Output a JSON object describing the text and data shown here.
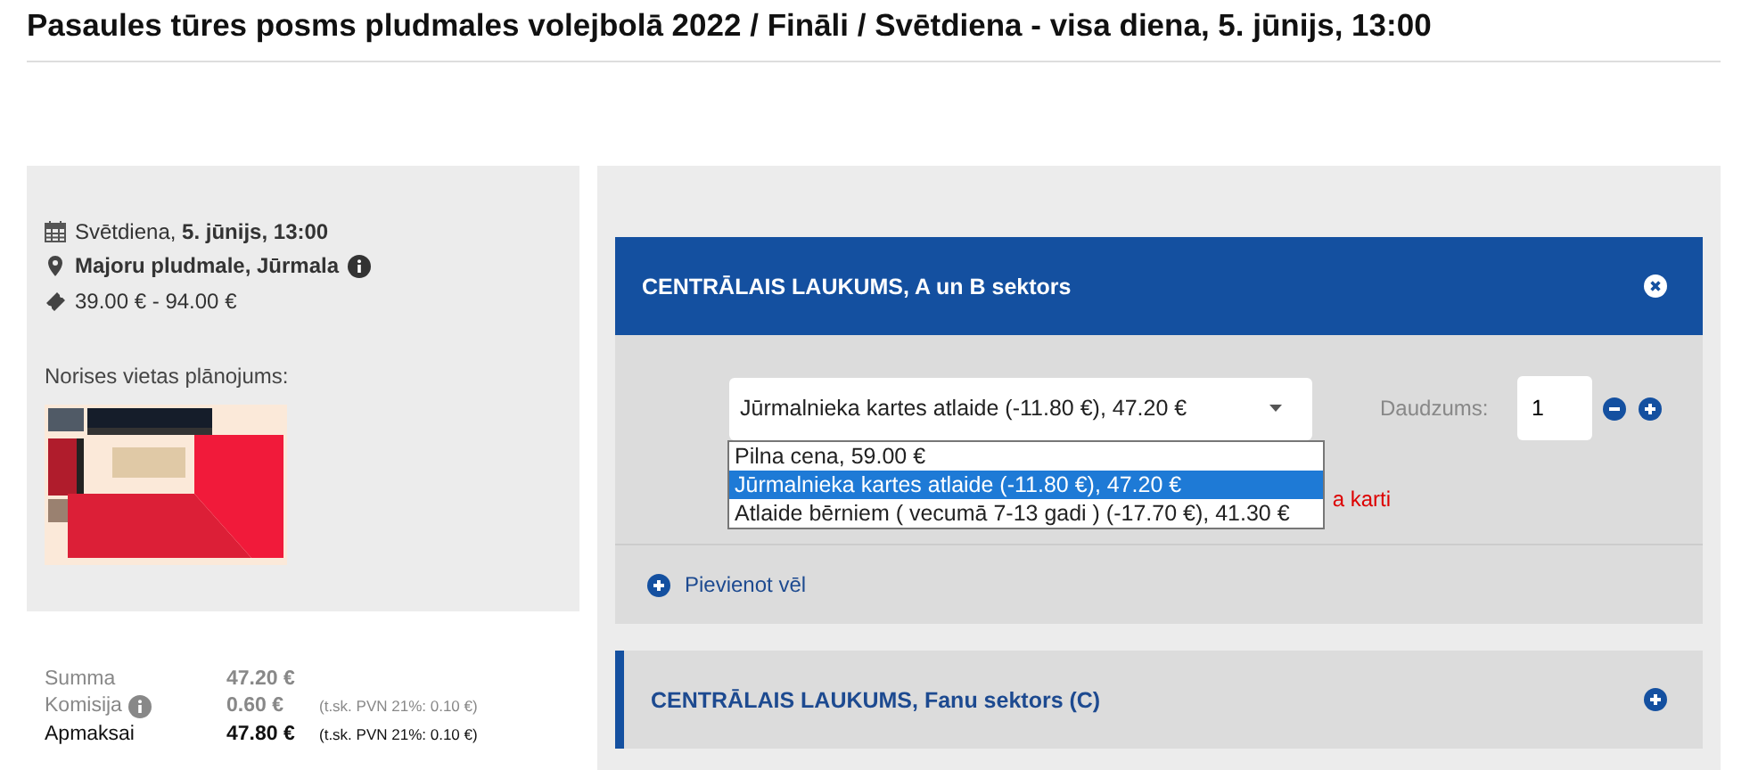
{
  "title": "Pasaules tūres posms pludmales volejbolā 2022 / Fināli / Svētdiena - visa diena, 5. jūnijs, 13:00",
  "event": {
    "date": "Svētdiena, **5. jūnijs, 13:00**",
    "venue": "Majoru pludmale, Jūrmala",
    "price": "39.00 € - 94.00 €",
    "plan_label": "Norises vietas plānojums:"
  },
  "summary": [
    {
      "label": "Summa",
      "value": "47.20 €",
      "info": false,
      "emphasis": false
    },
    {
      "label": "Komisija",
      "value": "0.60 €",
      "note": "(t.sk. PVN 21%: 0.10 €)",
      "info": true,
      "emphasis": false
    },
    {
      "label": "Apmaksai",
      "value": "47.80 €",
      "note": "(t.sk. PVN 21%: 0.10 €)",
      "info": false,
      "emphasis": true
    }
  ],
  "sections": [
    {
      "title": "CENTRĀLAIS LAUKUMS, A un B sektors",
      "expanded": true,
      "ticket": {
        "value": "Jūrmalnieka kartes atlaide (-11.80 €), 47.20 €",
        "options": [
          {
            "label": "Pilna cena, 59.00 €",
            "selected": false
          },
          {
            "label": "Jūrmalnieka kartes atlaide (-11.80 €), 47.20 €",
            "selected": true
          },
          {
            "label": "Atlaide bērniem ( vecumā 7-13 gadi ) (-17.70 €), 41.30 €",
            "selected": false
          }
        ]
      },
      "quantity_label": "Daudzums:",
      "quantity": "1",
      "warning": "a karti",
      "add_more": "Pievienot vēl"
    },
    {
      "title": "CENTRĀLAIS LAUKUMS, Fanu sektors (C)",
      "expanded": false
    }
  ]
}
